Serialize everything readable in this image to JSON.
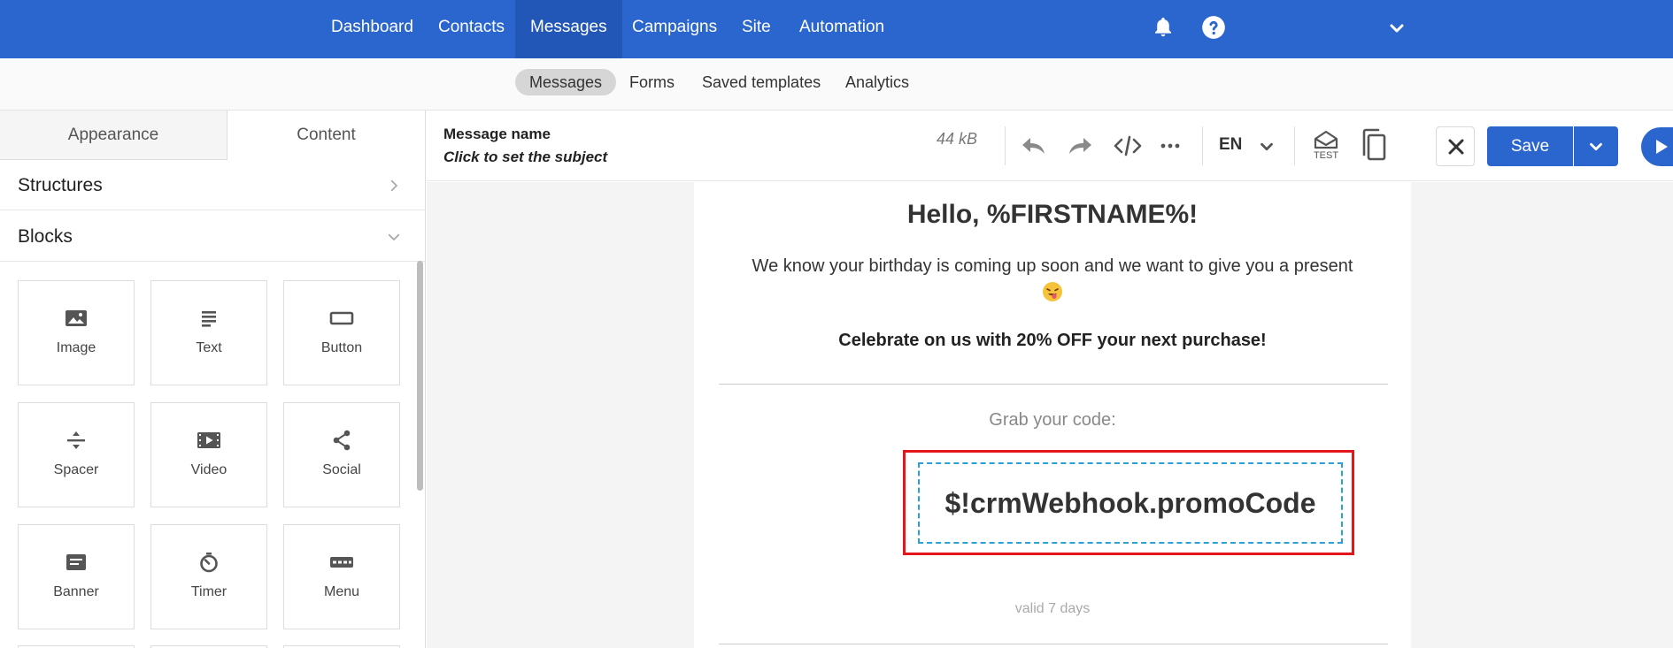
{
  "topnav": {
    "items": [
      "Dashboard",
      "Contacts",
      "Messages",
      "Campaigns",
      "Site",
      "Automation"
    ],
    "active": "Messages",
    "icons": [
      "bell-icon",
      "help-icon",
      "chevron-down-icon"
    ]
  },
  "subnav": {
    "items": [
      "Messages",
      "Forms",
      "Saved templates",
      "Analytics"
    ],
    "active": "Messages"
  },
  "leftpanel": {
    "tabs": [
      "Appearance",
      "Content"
    ],
    "active_tab": "Content",
    "structures_label": "Structures",
    "blocks_label": "Blocks",
    "blocks": [
      {
        "label": "Image",
        "icon": "image-icon"
      },
      {
        "label": "Text",
        "icon": "text-icon"
      },
      {
        "label": "Button",
        "icon": "button-icon"
      },
      {
        "label": "Spacer",
        "icon": "spacer-icon"
      },
      {
        "label": "Video",
        "icon": "video-icon"
      },
      {
        "label": "Social",
        "icon": "share-icon"
      },
      {
        "label": "Banner",
        "icon": "banner-icon"
      },
      {
        "label": "Timer",
        "icon": "timer-icon"
      },
      {
        "label": "Menu",
        "icon": "menu-icon"
      }
    ]
  },
  "toolbar": {
    "message_name": "Message name",
    "subject_prompt": "Click to set the subject",
    "size": "44 kB",
    "language": "EN",
    "test_label": "TEST",
    "save_label": "Save"
  },
  "email": {
    "greeting": "Hello, %FIRSTNAME%!",
    "paragraph": "We know your birthday is coming up soon and we want to give you a present",
    "celebrate": "Celebrate on us with 20% OFF your next purchase!",
    "grab": "Grab your code:",
    "code": "$!crmWebhook.promoCode",
    "valid": "valid 7 days"
  },
  "colors": {
    "brand": "#2b66cf",
    "highlight": "#e5161b",
    "dashed": "#2a9fd8"
  }
}
